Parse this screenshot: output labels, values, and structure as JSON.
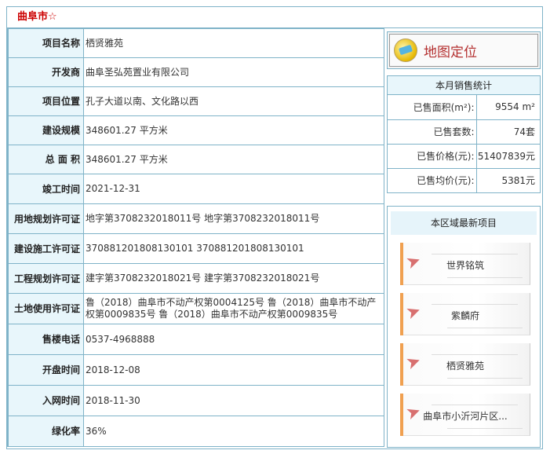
{
  "header": {
    "title": "曲阜市☆"
  },
  "project": [
    {
      "label": "项目名称",
      "value": "栖贤雅苑"
    },
    {
      "label": "开发商",
      "value": "曲阜圣弘苑置业有限公司"
    },
    {
      "label": "项目位置",
      "value": "孔子大道以南、文化路以西"
    },
    {
      "label": "建设规模",
      "value": "348601.27 平方米"
    },
    {
      "label": "总 面 积",
      "value": "348601.27 平方米"
    },
    {
      "label": "竣工时间",
      "value": "2021-12-31"
    },
    {
      "label": "用地规划许可证",
      "value": "地字第3708232018011号 地字第3708232018011号"
    },
    {
      "label": "建设施工许可证",
      "value": "370881201808130101 370881201808130101"
    },
    {
      "label": "工程规划许可证",
      "value": "建字第3708232018021号 建字第3708232018021号"
    },
    {
      "label": "土地使用许可证",
      "value": "鲁（2018）曲阜市不动产权第0004125号 鲁（2018）曲阜市不动产权第0009835号 鲁（2018）曲阜市不动产权第0009835号"
    },
    {
      "label": "售楼电话",
      "value": "0537-4968888"
    },
    {
      "label": "开盘时间",
      "value": "2018-12-08"
    },
    {
      "label": "入网时间",
      "value": "2018-11-30"
    },
    {
      "label": "绿化率",
      "value": "36%"
    }
  ],
  "map_button": {
    "label": "地图定位",
    "icon": "map-globe-icon"
  },
  "sales": {
    "title": "本月销售统计",
    "rows": [
      {
        "label": "已售面积(m²):",
        "value": "9554 m²"
      },
      {
        "label": "已售套数:",
        "value": "74套"
      },
      {
        "label": "已售价格(元):",
        "value": "51407839元"
      },
      {
        "label": "已售均价(元):",
        "value": "5381元"
      }
    ]
  },
  "recent": {
    "title": "本区域最新项目",
    "items": [
      {
        "name": "世界铭筑"
      },
      {
        "name": "紫麟府"
      },
      {
        "name": "栖贤雅苑"
      },
      {
        "name": "曲阜市小沂河片区..."
      }
    ]
  },
  "colors": {
    "border": "#7fb3c8",
    "label_bg": "#e8f6fb",
    "title": "#cc0000",
    "map_text": "#b43030"
  }
}
